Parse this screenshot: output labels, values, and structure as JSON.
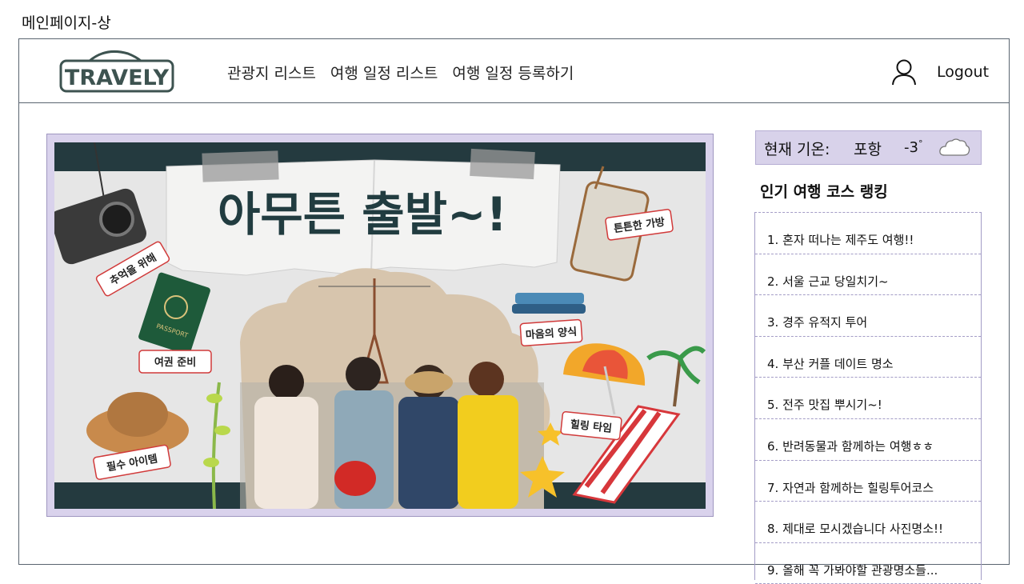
{
  "page_label": "메인페이지-상",
  "header": {
    "logo_text": "TRAVELY",
    "nav": [
      "관광지 리스트",
      "여행 일정 리스트",
      "여행 일정 등록하기"
    ],
    "logout_label": "Logout"
  },
  "banner": {
    "title": "아무튼 출발~!",
    "stickers": {
      "camera": "추억을 위해",
      "bag": "튼튼한 가방",
      "passport": "여권 준비",
      "book": "마음의 양식",
      "healing": "힐링 타임",
      "hat": "필수 아이템"
    },
    "passport_text": "PASSPORT"
  },
  "weather": {
    "label": "현재 기온:",
    "city": "포항",
    "temp": "-3",
    "unit": "°"
  },
  "ranking": {
    "title": "인기 여행 코스 랭킹",
    "items": [
      "1. 혼자 떠나는 제주도 여행!!",
      "2. 서울 근교 당일치기~",
      "3. 경주 유적지 투어",
      "4. 부산 커플 데이트 명소",
      "5. 전주 맛집 뿌시기~!",
      "6. 반려동물과 함께하는 여행ㅎㅎ",
      "7. 자연과 함께하는 힐링투어코스",
      "8. 제대로 모시겠습니다 사진명소!!",
      "9. 올해 꼭 가봐야할 관광명소들..."
    ]
  },
  "colors": {
    "accent_lavender": "#d8d2ea",
    "border_lavender": "#a39cc6",
    "frame_border": "#5a6470",
    "logo_dark": "#3d5350"
  }
}
